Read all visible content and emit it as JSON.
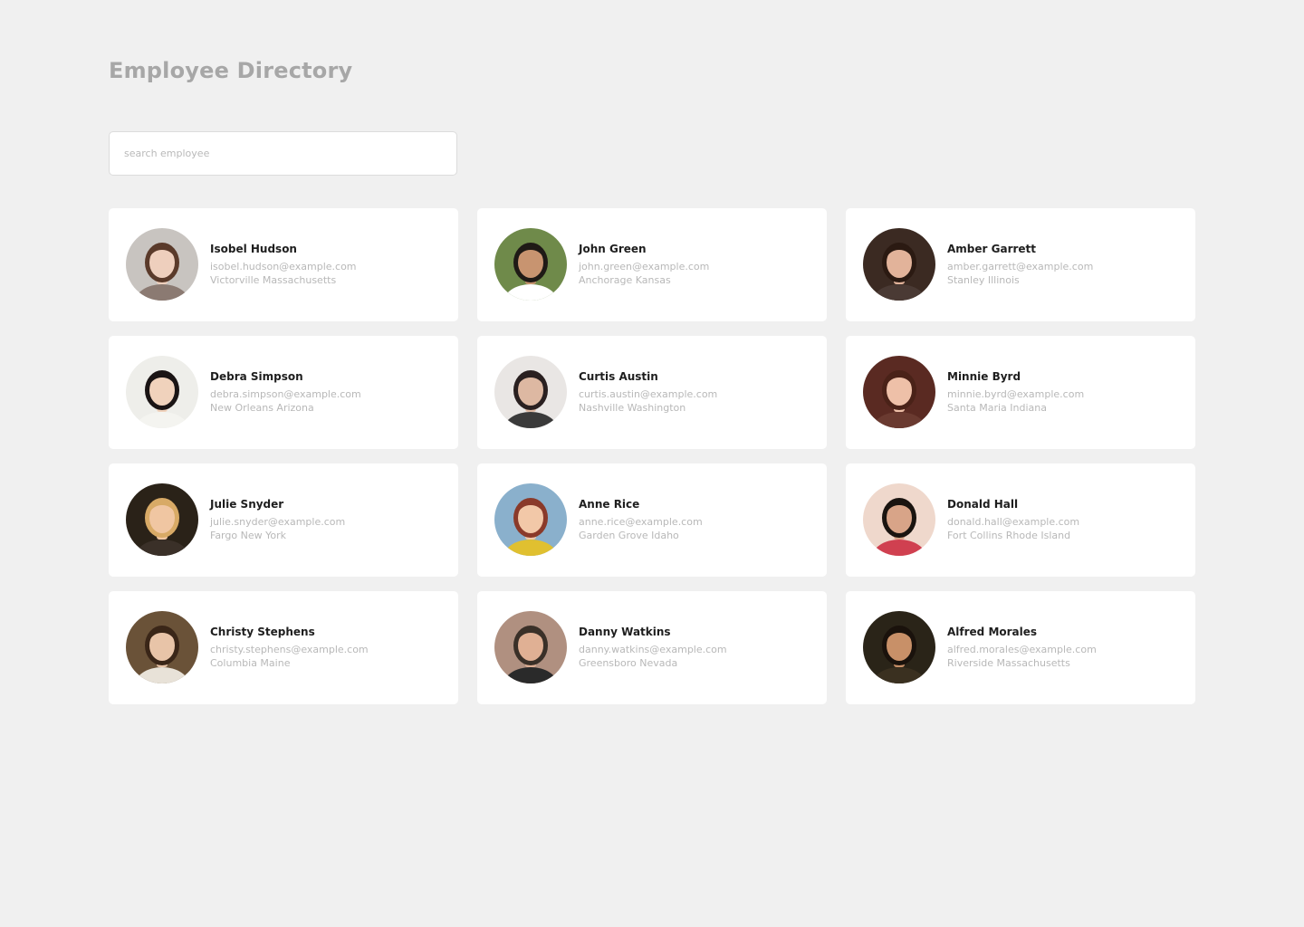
{
  "page": {
    "title": "Employee Directory"
  },
  "search": {
    "placeholder": "search employee",
    "value": ""
  },
  "employees": [
    {
      "name": "Isobel Hudson",
      "email": "isobel.hudson@example.com",
      "location": "Victorville Massachusetts",
      "bg": "#c8c4c0",
      "skin": "#eecfbd",
      "hair": "#5a3a2a",
      "shirt": "#8b7a72"
    },
    {
      "name": "John Green",
      "email": "john.green@example.com",
      "location": "Anchorage Kansas",
      "bg": "#6f8a4a",
      "skin": "#c89470",
      "hair": "#1f1a16",
      "shirt": "#ffffff"
    },
    {
      "name": "Amber Garrett",
      "email": "amber.garrett@example.com",
      "location": "Stanley Illinois",
      "bg": "#3b2a22",
      "skin": "#e2b39a",
      "hair": "#2b1a12",
      "shirt": "#4a3a34"
    },
    {
      "name": "Debra Simpson",
      "email": "debra.simpson@example.com",
      "location": "New Orleans Arizona",
      "bg": "#eeeeea",
      "skin": "#f0d2bc",
      "hair": "#1a1414",
      "shirt": "#f4f4f0"
    },
    {
      "name": "Curtis Austin",
      "email": "curtis.austin@example.com",
      "location": "Nashville Washington",
      "bg": "#e9e6e4",
      "skin": "#ddb8a2",
      "hair": "#2a2020",
      "shirt": "#3a3a3a"
    },
    {
      "name": "Minnie Byrd",
      "email": "minnie.byrd@example.com",
      "location": "Santa Maria Indiana",
      "bg": "#5a2a22",
      "skin": "#eec0a8",
      "hair": "#4a2218",
      "shirt": "#6a3a30"
    },
    {
      "name": "Julie Snyder",
      "email": "julie.snyder@example.com",
      "location": "Fargo New York",
      "bg": "#2a2218",
      "skin": "#f0c6a2",
      "hair": "#d8aa66",
      "shirt": "#3a3028"
    },
    {
      "name": "Anne Rice",
      "email": "anne.rice@example.com",
      "location": "Garden Grove Idaho",
      "bg": "#8ab0cc",
      "skin": "#f2c8a8",
      "hair": "#8a3a2a",
      "shirt": "#e0c030"
    },
    {
      "name": "Donald Hall",
      "email": "donald.hall@example.com",
      "location": "Fort Collins Rhode Island",
      "bg": "#efd8cc",
      "skin": "#d8a488",
      "hair": "#1a1410",
      "shirt": "#d04050"
    },
    {
      "name": "Christy Stephens",
      "email": "christy.stephens@example.com",
      "location": "Columbia Maine",
      "bg": "#6a5238",
      "skin": "#e8c4a8",
      "hair": "#3a2618",
      "shirt": "#e8e2d8"
    },
    {
      "name": "Danny Watkins",
      "email": "danny.watkins@example.com",
      "location": "Greensboro Nevada",
      "bg": "#b09080",
      "skin": "#e0b094",
      "hair": "#3a3028",
      "shirt": "#2a2a2a"
    },
    {
      "name": "Alfred Morales",
      "email": "alfred.morales@example.com",
      "location": "Riverside Massachusetts",
      "bg": "#2a2418",
      "skin": "#c89068",
      "hair": "#1a120c",
      "shirt": "#3a3020"
    }
  ]
}
